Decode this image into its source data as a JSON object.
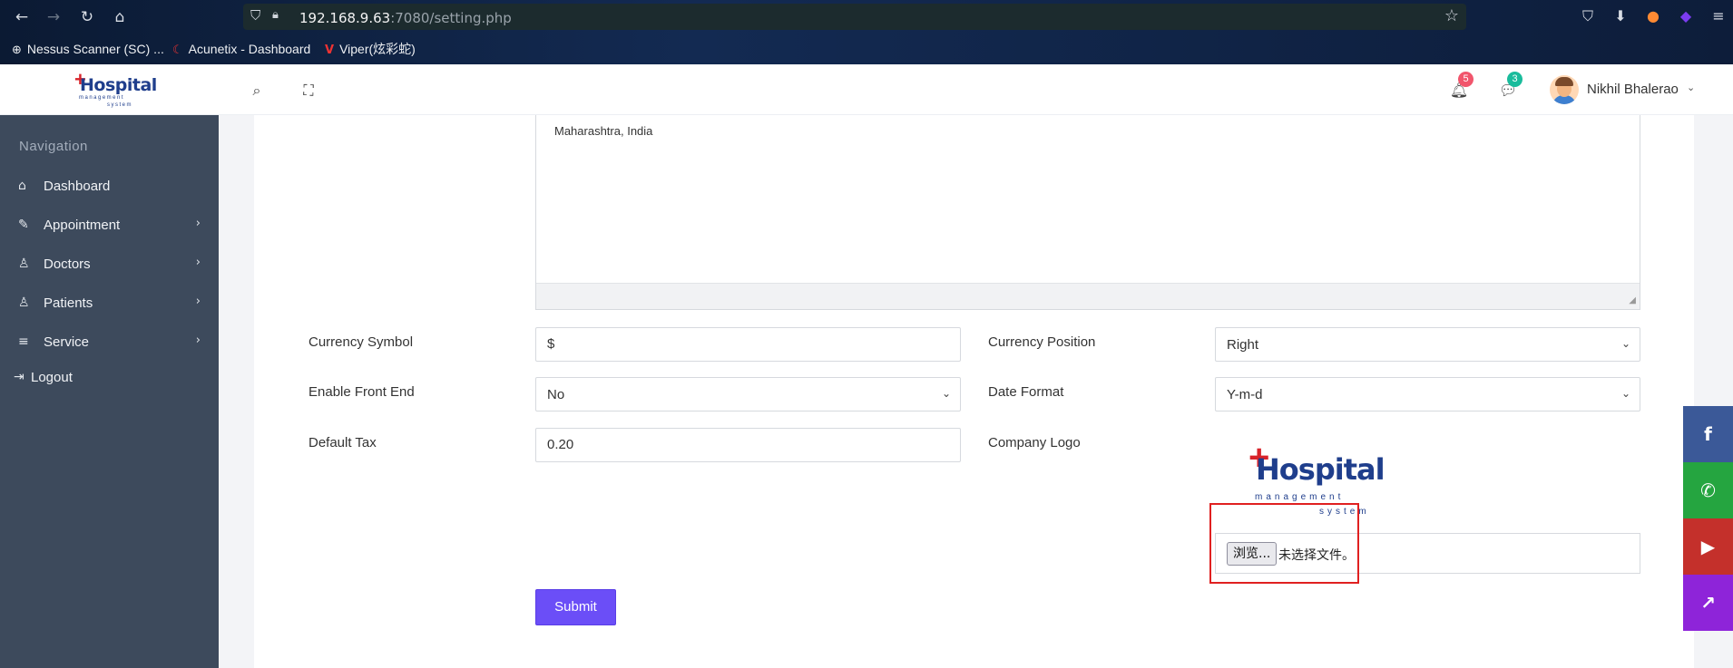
{
  "browser": {
    "url_host": "192.168.9.63",
    "url_rest": ":7080/setting.php",
    "bookmarks": [
      {
        "label": "Nessus Scanner (SC) ..."
      },
      {
        "label": "Acunetix - Dashboard"
      },
      {
        "label": "Viper(炫彩蛇)"
      }
    ]
  },
  "header": {
    "logo": {
      "cross": "+",
      "word": "Hospital",
      "sub1": "management",
      "sub2": "system"
    },
    "notifications_count": "5",
    "messages_count": "3",
    "user_name": "Nikhil Bhalerao",
    "colors": {
      "notif_badge": "#f1556c",
      "msg_badge": "#1abc9c"
    }
  },
  "sidebar": {
    "title": "Navigation",
    "items": [
      {
        "label": "Dashboard",
        "icon": "home-icon",
        "glyph": "⌂",
        "has_arrow": false
      },
      {
        "label": "Appointment",
        "icon": "edit-icon",
        "glyph": "✎",
        "has_arrow": true
      },
      {
        "label": "Doctors",
        "icon": "user-icon",
        "glyph": "♙",
        "has_arrow": true
      },
      {
        "label": "Patients",
        "icon": "user-icon",
        "glyph": "♙",
        "has_arrow": true
      },
      {
        "label": "Service",
        "icon": "menu-icon",
        "glyph": "≡",
        "has_arrow": true
      }
    ],
    "logout_label": "Logout",
    "arrow": "›"
  },
  "form": {
    "address_text": "Maharashtra, India",
    "currency_symbol_label": "Currency Symbol",
    "currency_symbol_value": "$",
    "currency_position_label": "Currency Position",
    "currency_position_value": "Right",
    "enable_front_end_label": "Enable Front End",
    "enable_front_end_value": "No",
    "date_format_label": "Date Format",
    "date_format_value": "Y-m-d",
    "default_tax_label": "Default Tax",
    "default_tax_value": "0.20",
    "company_logo_label": "Company Logo",
    "logo": {
      "cross": "+",
      "word": "Hospital",
      "sub1": "management",
      "sub2": "system"
    },
    "file_button_label": "浏览...",
    "file_status": "未选择文件。",
    "submit_label": "Submit"
  },
  "social": [
    {
      "name": "facebook-icon",
      "glyph": "f",
      "color": "#3b5998"
    },
    {
      "name": "whatsapp-icon",
      "glyph": "✆",
      "color": "#25a540"
    },
    {
      "name": "youtube-icon",
      "glyph": "▶",
      "color": "#c4302b"
    },
    {
      "name": "share-icon",
      "glyph": "↗",
      "color": "#8e24d9"
    }
  ]
}
